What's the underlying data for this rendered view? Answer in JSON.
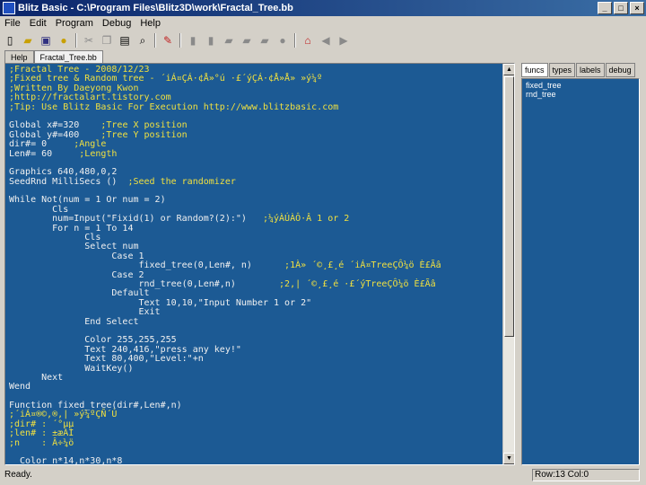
{
  "window": {
    "title": "Blitz Basic - C:\\Program Files\\Blitz3D\\work\\Fractal_Tree.bb",
    "min": "_",
    "max": "□",
    "close": "×"
  },
  "menu": [
    "File",
    "Edit",
    "Program",
    "Debug",
    "Help"
  ],
  "toolbar_icons": [
    "new-icon",
    "open-icon",
    "save-icon",
    "bulb-icon",
    "cut-icon",
    "copy-icon",
    "paste-icon",
    "find-icon",
    "run-icon",
    "doc1-icon",
    "doc2-icon",
    "doc3-icon",
    "doc4-icon",
    "doc5-icon",
    "doc6-icon",
    "home-icon",
    "back-icon",
    "forward-icon"
  ],
  "tabs": [
    "Help",
    "Fractal_Tree.bb"
  ],
  "code": [
    {
      "t": ";Fractal Tree - 2008/12/23",
      "c": "comment"
    },
    {
      "t": ";Fixed tree & Random tree - ´iÁ¤ÇÁ·¢Å»°ú ·£´ýÇÁ·¢Å»Å» »ý¼º",
      "c": "comment"
    },
    {
      "t": ";Written By Daeyong Kwon",
      "c": "comment"
    },
    {
      "t": ";http://fractalart.tistory.com",
      "c": "comment"
    },
    {
      "t": ";Tip: Use Blitz Basic For Execution http://www.blitzbasic.com",
      "c": "comment"
    },
    {
      "t": "",
      "c": "code"
    },
    {
      "t": "Global x#=320    ;Tree X position",
      "c": "mixed",
      "code": "Global x#=320    ",
      "comment": ";Tree X position"
    },
    {
      "t": "Global y#=400    ;Tree Y position",
      "c": "mixed",
      "code": "Global y#=400    ",
      "comment": ";Tree Y position"
    },
    {
      "t": "dir#= 0     ;Angle",
      "c": "mixed",
      "code": "dir#= 0     ",
      "comment": ";Angle"
    },
    {
      "t": "Len#= 60     ;Length",
      "c": "mixed",
      "code": "Len#= 60     ",
      "comment": ";Length"
    },
    {
      "t": "",
      "c": "code"
    },
    {
      "t": "Graphics 640,480,0,2",
      "c": "code"
    },
    {
      "t": "SeedRnd MilliSecs ()  ;Seed the randomizer",
      "c": "mixed",
      "code": "SeedRnd MilliSecs ()  ",
      "comment": ";Seed the randomizer"
    },
    {
      "t": "",
      "c": "code"
    },
    {
      "t": "While Not(num = 1 Or num = 2)",
      "c": "code"
    },
    {
      "t": "        Cls",
      "c": "code"
    },
    {
      "t": "        num=Input(\"Fixid(1) or Random?(2):\")   ;¼ýÀÚÀÔ·Â 1 or 2",
      "c": "mixed",
      "code": "        num=Input(\"Fixid(1) or Random?(2):\")   ",
      "comment": ";¼ýÀÚÀÔ·Â 1 or 2"
    },
    {
      "t": "        For n = 1 To 14",
      "c": "code"
    },
    {
      "t": "              Cls",
      "c": "code"
    },
    {
      "t": "              Select num",
      "c": "code"
    },
    {
      "t": "                   Case 1",
      "c": "code"
    },
    {
      "t": "                        fixed_tree(0,Len#, n)      ;1À» ´©¸£¸é ´iÁ¤TreeÇÔ¼ö È£Ãâ",
      "c": "mixed",
      "code": "                        fixed_tree(0,Len#, n)      ",
      "comment": ";1À» ´©¸£¸é ´iÁ¤TreeÇÔ¼ö È£Ãâ"
    },
    {
      "t": "                   Case 2",
      "c": "code"
    },
    {
      "t": "                        rnd_tree(0,Len#,n)        ;2,| ´©¸£¸é ·£´ýTreeÇÔ¼ö È£Ãâ",
      "c": "mixed",
      "code": "                        rnd_tree(0,Len#,n)        ",
      "comment": ";2,| ´©¸£¸é ·£´ýTreeÇÔ¼ö È£Ãâ"
    },
    {
      "t": "                   Default",
      "c": "code"
    },
    {
      "t": "                        Text 10,10,\"Input Number 1 or 2\"",
      "c": "code"
    },
    {
      "t": "                        Exit",
      "c": "code"
    },
    {
      "t": "              End Select",
      "c": "code"
    },
    {
      "t": "",
      "c": "code"
    },
    {
      "t": "              Color 255,255,255",
      "c": "code"
    },
    {
      "t": "              Text 240,416,\"press any key!\"",
      "c": "code"
    },
    {
      "t": "              Text 80,400,\"Level:\"+n",
      "c": "code"
    },
    {
      "t": "              WaitKey()",
      "c": "code"
    },
    {
      "t": "      Next",
      "c": "code"
    },
    {
      "t": "Wend",
      "c": "code"
    },
    {
      "t": "",
      "c": "code"
    },
    {
      "t": "Function fixed_tree(dir#,Len#,n)",
      "c": "code"
    },
    {
      "t": ";´iÁ¤®©,®,| »ý¼ºÇÑ´Ù",
      "c": "comment"
    },
    {
      "t": ";dir# : ´°µµ",
      "c": "comment"
    },
    {
      "t": ";len# : ±æÀÌ",
      "c": "comment"
    },
    {
      "t": ";n    : Â÷¼ö",
      "c": "comment"
    },
    {
      "t": "",
      "c": "code"
    },
    {
      "t": "  Color n*14,n*30,n*8",
      "c": "code"
    }
  ],
  "right_tabs": [
    "funcs",
    "types",
    "labels",
    "debug"
  ],
  "funcs": [
    "fixed_tree",
    "rnd_tree"
  ],
  "status": {
    "left": "Ready.",
    "right": "Row:13 Col:0"
  },
  "colors": {
    "editor_bg": "#1c5a94",
    "comment": "#f0e040",
    "code": "#f0f0f0"
  }
}
